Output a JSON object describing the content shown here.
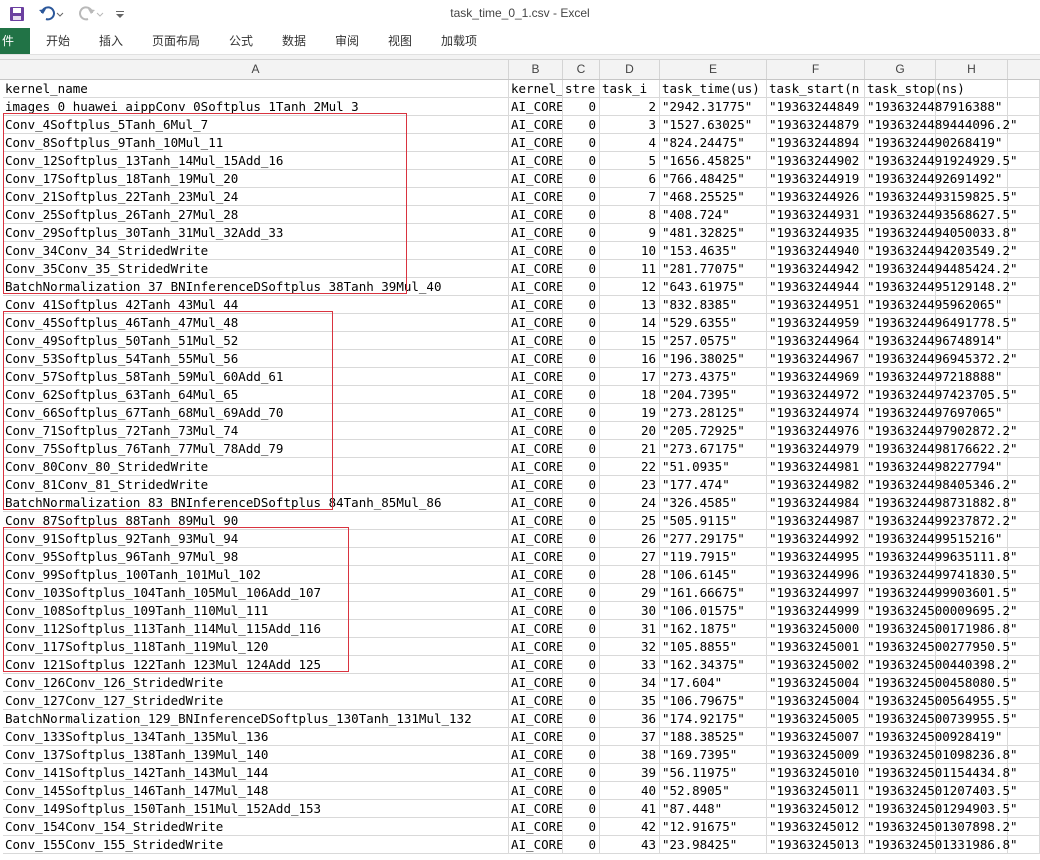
{
  "window": {
    "title": "task_time_0_1.csv - Excel"
  },
  "quick_access": {
    "save_icon": "save-icon",
    "undo_icon": "undo-icon",
    "redo_icon": "redo-icon",
    "customize_icon": "customize-icon"
  },
  "ribbon": {
    "tabs": [
      "件",
      "开始",
      "插入",
      "页面布局",
      "公式",
      "数据",
      "审阅",
      "视图",
      "加载项"
    ]
  },
  "columns": [
    "A",
    "B",
    "C",
    "D",
    "E",
    "F",
    "G",
    "H"
  ],
  "header_row": [
    "kernel_name",
    "kernel_stre",
    "stre",
    "task_i",
    "task_time(us)",
    "task_start(n",
    "task_stop(ns)",
    ""
  ],
  "rows": [
    [
      "images_0_huawei_aippConv_0Softplus_1Tanh_2Mul_3",
      "AI_CORE",
      "0",
      "2",
      "\"2942.31775\"",
      "\"19363244849",
      "\"1936324487916388\""
    ],
    [
      "Conv_4Softplus_5Tanh_6Mul_7",
      "AI_CORE",
      "0",
      "3",
      "\"1527.63025\"",
      "\"19363244879",
      "\"1936324489444096.2\""
    ],
    [
      "Conv_8Softplus_9Tanh_10Mul_11",
      "AI_CORE",
      "0",
      "4",
      "\"824.24475\"",
      "\"19363244894",
      "\"1936324490268419\""
    ],
    [
      "Conv_12Softplus_13Tanh_14Mul_15Add_16",
      "AI_CORE",
      "0",
      "5",
      "\"1656.45825\"",
      "\"19363244902",
      "\"1936324491924929.5\""
    ],
    [
      "Conv_17Softplus_18Tanh_19Mul_20",
      "AI_CORE",
      "0",
      "6",
      "\"766.48425\"",
      "\"19363244919",
      "\"1936324492691492\""
    ],
    [
      "Conv_21Softplus_22Tanh_23Mul_24",
      "AI_CORE",
      "0",
      "7",
      "\"468.25525\"",
      "\"19363244926",
      "\"1936324493159825.5\""
    ],
    [
      "Conv_25Softplus_26Tanh_27Mul_28",
      "AI_CORE",
      "0",
      "8",
      "\"408.724\"",
      "\"19363244931",
      "\"1936324493568627.5\""
    ],
    [
      "Conv_29Softplus_30Tanh_31Mul_32Add_33",
      "AI_CORE",
      "0",
      "9",
      "\"481.32825\"",
      "\"19363244935",
      "\"1936324494050033.8\""
    ],
    [
      "Conv_34Conv_34_StridedWrite",
      "AI_CORE",
      "0",
      "10",
      "\"153.4635\"",
      "\"19363244940",
      "\"1936324494203549.2\""
    ],
    [
      "Conv_35Conv_35_StridedWrite",
      "AI_CORE",
      "0",
      "11",
      "\"281.77075\"",
      "\"19363244942",
      "\"1936324494485424.2\""
    ],
    [
      "BatchNormalization_37_BNInferenceDSoftplus_38Tanh_39Mul_40",
      "AI_CORE",
      "0",
      "12",
      "\"643.61975\"",
      "\"19363244944",
      "\"1936324495129148.2\""
    ],
    [
      "Conv_41Softplus_42Tanh_43Mul_44",
      "AI_CORE",
      "0",
      "13",
      "\"832.8385\"",
      "\"19363244951",
      "\"1936324495962065\""
    ],
    [
      "Conv_45Softplus_46Tanh_47Mul_48",
      "AI_CORE",
      "0",
      "14",
      "\"529.6355\"",
      "\"19363244959",
      "\"1936324496491778.5\""
    ],
    [
      "Conv_49Softplus_50Tanh_51Mul_52",
      "AI_CORE",
      "0",
      "15",
      "\"257.0575\"",
      "\"19363244964",
      "\"1936324496748914\""
    ],
    [
      "Conv_53Softplus_54Tanh_55Mul_56",
      "AI_CORE",
      "0",
      "16",
      "\"196.38025\"",
      "\"19363244967",
      "\"1936324496945372.2\""
    ],
    [
      "Conv_57Softplus_58Tanh_59Mul_60Add_61",
      "AI_CORE",
      "0",
      "17",
      "\"273.4375\"",
      "\"19363244969",
      "\"1936324497218888\""
    ],
    [
      "Conv_62Softplus_63Tanh_64Mul_65",
      "AI_CORE",
      "0",
      "18",
      "\"204.7395\"",
      "\"19363244972",
      "\"1936324497423705.5\""
    ],
    [
      "Conv_66Softplus_67Tanh_68Mul_69Add_70",
      "AI_CORE",
      "0",
      "19",
      "\"273.28125\"",
      "\"19363244974",
      "\"1936324497697065\""
    ],
    [
      "Conv_71Softplus_72Tanh_73Mul_74",
      "AI_CORE",
      "0",
      "20",
      "\"205.72925\"",
      "\"19363244976",
      "\"1936324497902872.2\""
    ],
    [
      "Conv_75Softplus_76Tanh_77Mul_78Add_79",
      "AI_CORE",
      "0",
      "21",
      "\"273.67175\"",
      "\"19363244979",
      "\"1936324498176622.2\""
    ],
    [
      "Conv_80Conv_80_StridedWrite",
      "AI_CORE",
      "0",
      "22",
      "\"51.0935\"",
      "\"19363244981",
      "\"1936324498227794\""
    ],
    [
      "Conv_81Conv_81_StridedWrite",
      "AI_CORE",
      "0",
      "23",
      "\"177.474\"",
      "\"19363244982",
      "\"1936324498405346.2\""
    ],
    [
      "BatchNormalization_83_BNInferenceDSoftplus_84Tanh_85Mul_86",
      "AI_CORE",
      "0",
      "24",
      "\"326.4585\"",
      "\"19363244984",
      "\"1936324498731882.8\""
    ],
    [
      "Conv_87Softplus_88Tanh_89Mul_90",
      "AI_CORE",
      "0",
      "25",
      "\"505.9115\"",
      "\"19363244987",
      "\"1936324499237872.2\""
    ],
    [
      "Conv_91Softplus_92Tanh_93Mul_94",
      "AI_CORE",
      "0",
      "26",
      "\"277.29175\"",
      "\"19363244992",
      "\"1936324499515216\""
    ],
    [
      "Conv_95Softplus_96Tanh_97Mul_98",
      "AI_CORE",
      "0",
      "27",
      "\"119.7915\"",
      "\"19363244995",
      "\"1936324499635111.8\""
    ],
    [
      "Conv_99Softplus_100Tanh_101Mul_102",
      "AI_CORE",
      "0",
      "28",
      "\"106.6145\"",
      "\"19363244996",
      "\"1936324499741830.5\""
    ],
    [
      "Conv_103Softplus_104Tanh_105Mul_106Add_107",
      "AI_CORE",
      "0",
      "29",
      "\"161.66675\"",
      "\"19363244997",
      "\"1936324499903601.5\""
    ],
    [
      "Conv_108Softplus_109Tanh_110Mul_111",
      "AI_CORE",
      "0",
      "30",
      "\"106.01575\"",
      "\"19363244999",
      "\"1936324500009695.2\""
    ],
    [
      "Conv_112Softplus_113Tanh_114Mul_115Add_116",
      "AI_CORE",
      "0",
      "31",
      "\"162.1875\"",
      "\"19363245000",
      "\"1936324500171986.8\""
    ],
    [
      "Conv_117Softplus_118Tanh_119Mul_120",
      "AI_CORE",
      "0",
      "32",
      "\"105.8855\"",
      "\"19363245001",
      "\"1936324500277950.5\""
    ],
    [
      "Conv_121Softplus_122Tanh_123Mul_124Add_125",
      "AI_CORE",
      "0",
      "33",
      "\"162.34375\"",
      "\"19363245002",
      "\"1936324500440398.2\""
    ],
    [
      "Conv_126Conv_126_StridedWrite",
      "AI_CORE",
      "0",
      "34",
      "\"17.604\"",
      "\"19363245004",
      "\"1936324500458080.5\""
    ],
    [
      "Conv_127Conv_127_StridedWrite",
      "AI_CORE",
      "0",
      "35",
      "\"106.79675\"",
      "\"19363245004",
      "\"1936324500564955.5\""
    ],
    [
      "BatchNormalization_129_BNInferenceDSoftplus_130Tanh_131Mul_132",
      "AI_CORE",
      "0",
      "36",
      "\"174.92175\"",
      "\"19363245005",
      "\"1936324500739955.5\""
    ],
    [
      "Conv_133Softplus_134Tanh_135Mul_136",
      "AI_CORE",
      "0",
      "37",
      "\"188.38525\"",
      "\"19363245007",
      "\"1936324500928419\""
    ],
    [
      "Conv_137Softplus_138Tanh_139Mul_140",
      "AI_CORE",
      "0",
      "38",
      "\"169.7395\"",
      "\"19363245009",
      "\"1936324501098236.8\""
    ],
    [
      "Conv_141Softplus_142Tanh_143Mul_144",
      "AI_CORE",
      "0",
      "39",
      "\"56.11975\"",
      "\"19363245010",
      "\"1936324501154434.8\""
    ],
    [
      "Conv_145Softplus_146Tanh_147Mul_148",
      "AI_CORE",
      "0",
      "40",
      "\"52.8905\"",
      "\"19363245011",
      "\"1936324501207403.5\""
    ],
    [
      "Conv_149Softplus_150Tanh_151Mul_152Add_153",
      "AI_CORE",
      "0",
      "41",
      "\"87.448\"",
      "\"19363245012",
      "\"1936324501294903.5\""
    ],
    [
      "Conv_154Conv_154_StridedWrite",
      "AI_CORE",
      "0",
      "42",
      "\"12.91675\"",
      "\"19363245012",
      "\"1936324501307898.2\""
    ],
    [
      "Conv_155Conv_155_StridedWrite",
      "AI_CORE",
      "0",
      "43",
      "\"23.98425\"",
      "\"19363245013",
      "\"1936324501331986.8\""
    ]
  ],
  "highlight_groups": [
    {
      "first_row": 1,
      "last_row": 10,
      "color": "#d9333f"
    },
    {
      "first_row": 12,
      "last_row": 22,
      "color": "#d9333f"
    },
    {
      "first_row": 24,
      "last_row": 31,
      "color": "#d9333f"
    }
  ]
}
